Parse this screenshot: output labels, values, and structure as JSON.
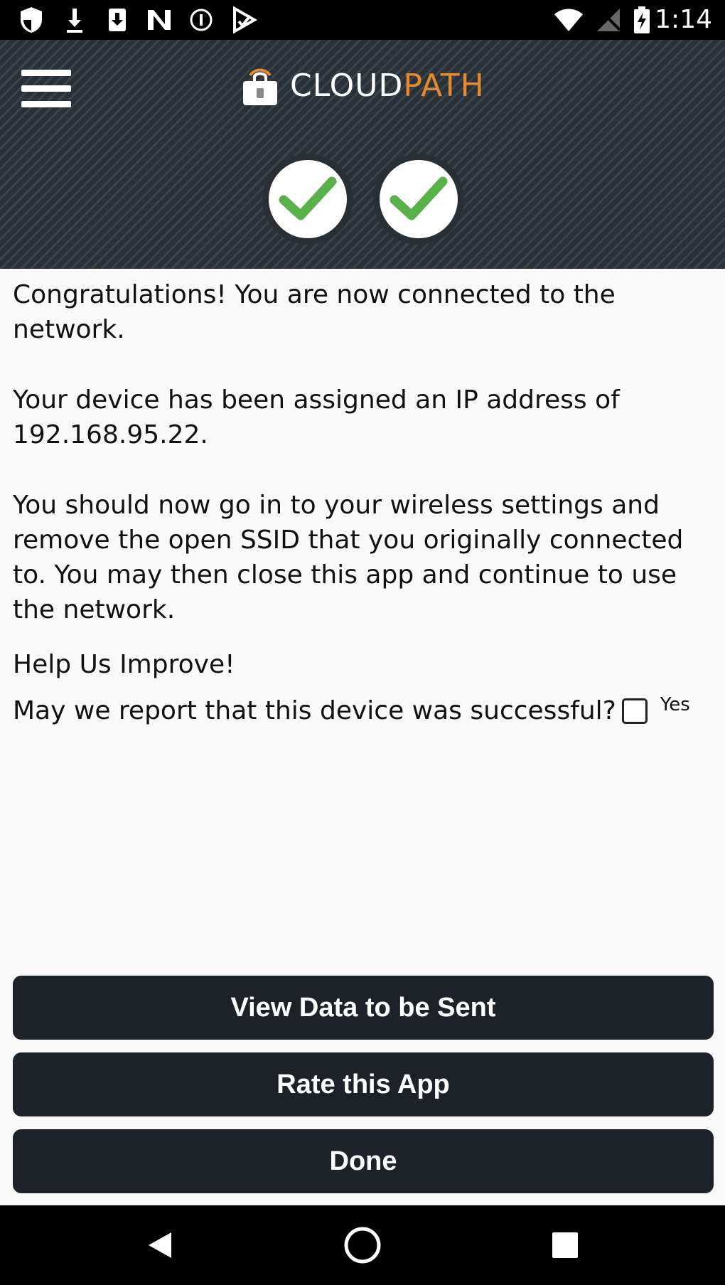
{
  "status_bar": {
    "time": "1:14",
    "icons": [
      "shield-icon",
      "download-icon",
      "download-box-icon",
      "n-app-icon",
      "circle-info-icon",
      "play-store-icon",
      "wifi-icon",
      "no-signal-icon",
      "battery-charging-icon"
    ]
  },
  "header": {
    "logo_part1": "CLOUD",
    "logo_part2": "PATH",
    "brand_color": "#e58a2f",
    "check_color": "#5ab04a"
  },
  "content": {
    "paragraph1": "Congratulations! You are now connected to the network.",
    "paragraph2": "Your device has been assigned an IP address of 192.168.95.22.",
    "paragraph3": "You should now go in to your wireless settings and remove the open SSID that you originally connected to. You may then close this app and continue to use the network.",
    "help_title": "Help Us Improve!",
    "report_question": "May we report that this device was successful?",
    "report_checkbox_label": "Yes"
  },
  "buttons": {
    "view_data": "View Data to be Sent",
    "rate_app": "Rate this App",
    "done": "Done"
  }
}
